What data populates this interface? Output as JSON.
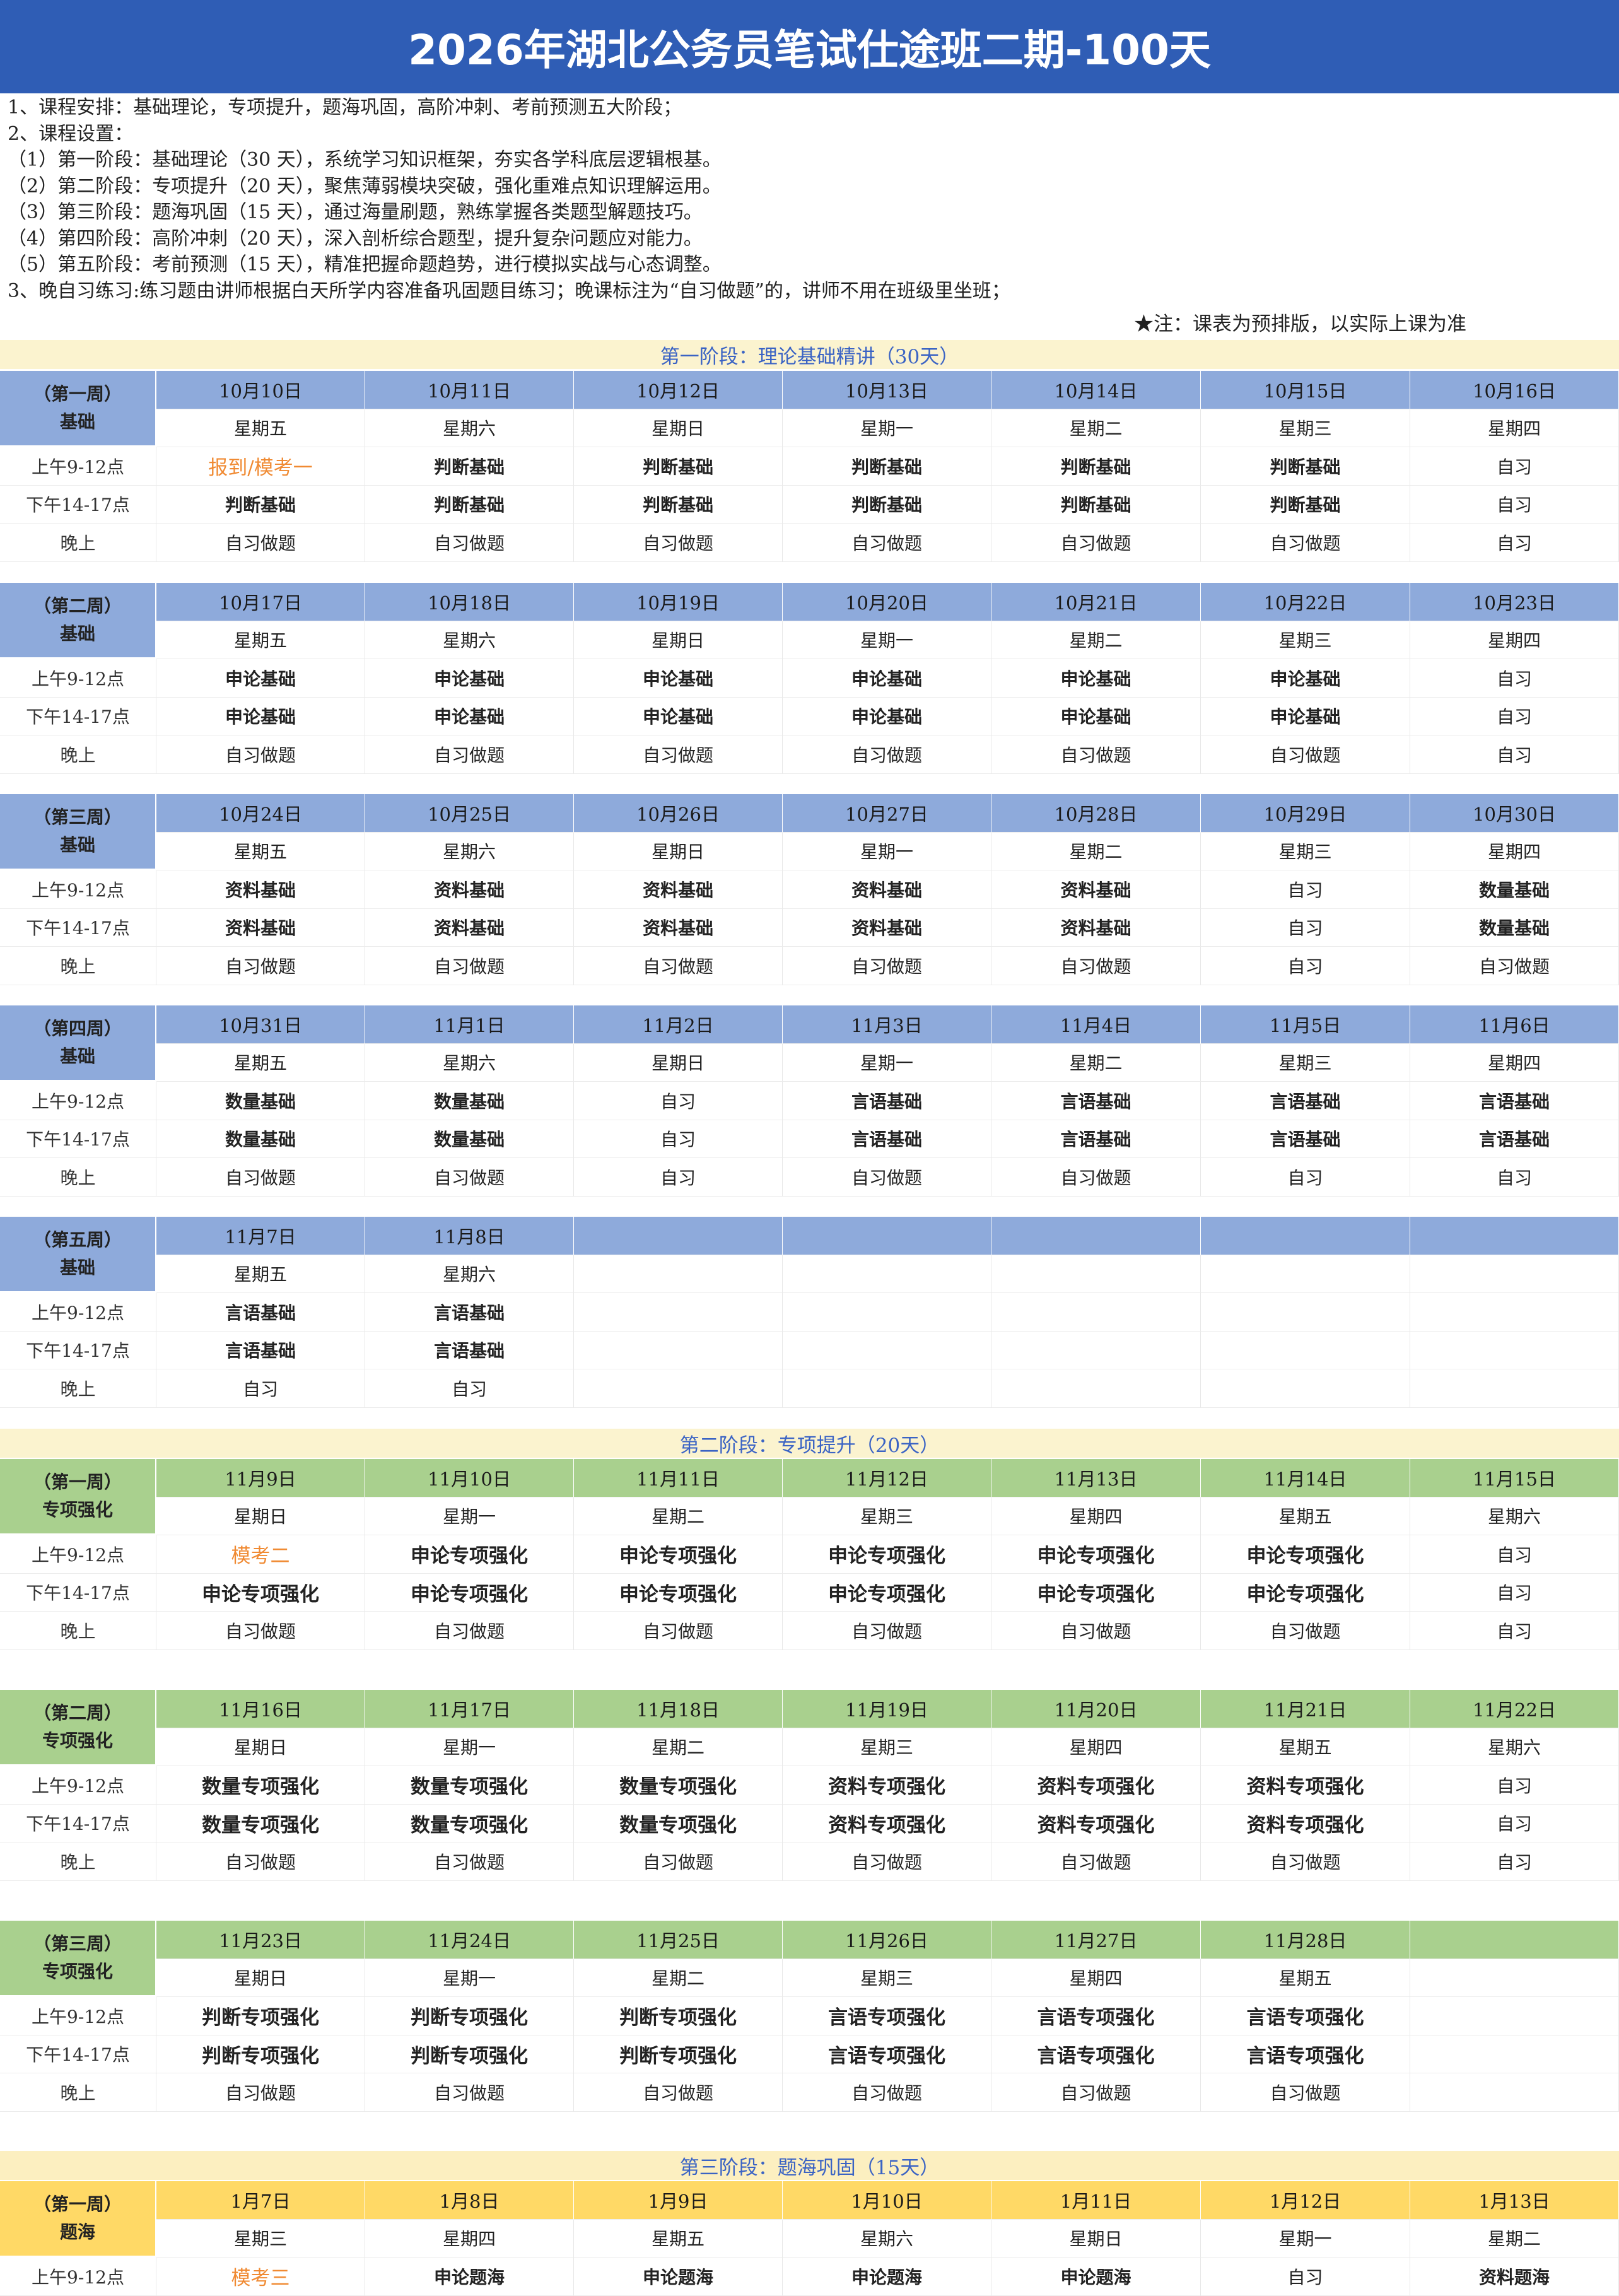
{
  "title": "2026年湖北公务员笔试仕途班二期-100天",
  "intro": [
    "1、课程安排：基础理论，专项提升，题海巩固，高阶冲刺、考前预测五大阶段；",
    "2、课程设置：",
    "（1）第一阶段：基础理论（30 天），系统学习知识框架，夯实各学科底层逻辑根基。",
    "（2）第二阶段：专项提升（20 天），聚焦薄弱模块突破，强化重难点知识理解运用。",
    "（3）第三阶段：题海巩固（15 天），通过海量刷题，熟练掌握各类题型解题技巧。",
    "（4）第四阶段：高阶冲刺（20 天），深入剖析综合题型，提升复杂问题应对能力。",
    "（5）第五阶段：考前预测（15 天），精准把握命题趋势，进行模拟实战与心态调整。",
    "3、晚自习练习:练习题由讲师根据白天所学内容准备巩固题目练习；晚课标注为“自习做题”的，讲师不用在班级里坐班；"
  ],
  "note": "★注：课表为预排版，以实际上课为准",
  "time_labels": [
    "上午9-12点",
    "下午14-17点",
    "晚上"
  ],
  "stages": [
    {
      "label": "第一阶段：理论基础精讲（30天）"
    },
    {
      "label": "第二阶段：专项提升（20天）"
    },
    {
      "label": "第三阶段：题海巩固（15天）"
    }
  ],
  "weeks": [
    {
      "label1": "（第一周）",
      "label2": "基础",
      "dates": [
        "10月10日",
        "10月11日",
        "10月12日",
        "10月13日",
        "10月14日",
        "10月15日",
        "10月16日"
      ],
      "days": [
        "星期五",
        "星期六",
        "星期日",
        "星期一",
        "星期二",
        "星期三",
        "星期四"
      ],
      "am": [
        "报到/模考一",
        "判断基础",
        "判断基础",
        "判断基础",
        "判断基础",
        "判断基础",
        "自习"
      ],
      "pm": [
        "判断基础",
        "判断基础",
        "判断基础",
        "判断基础",
        "判断基础",
        "判断基础",
        "自习"
      ],
      "eve": [
        "自习做题",
        "自习做题",
        "自习做题",
        "自习做题",
        "自习做题",
        "自习做题",
        "自习"
      ]
    },
    {
      "label1": "（第二周）",
      "label2": "基础",
      "dates": [
        "10月17日",
        "10月18日",
        "10月19日",
        "10月20日",
        "10月21日",
        "10月22日",
        "10月23日"
      ],
      "days": [
        "星期五",
        "星期六",
        "星期日",
        "星期一",
        "星期二",
        "星期三",
        "星期四"
      ],
      "am": [
        "申论基础",
        "申论基础",
        "申论基础",
        "申论基础",
        "申论基础",
        "申论基础",
        "自习"
      ],
      "pm": [
        "申论基础",
        "申论基础",
        "申论基础",
        "申论基础",
        "申论基础",
        "申论基础",
        "自习"
      ],
      "eve": [
        "自习做题",
        "自习做题",
        "自习做题",
        "自习做题",
        "自习做题",
        "自习做题",
        "自习"
      ]
    },
    {
      "label1": "（第三周）",
      "label2": "基础",
      "dates": [
        "10月24日",
        "10月25日",
        "10月26日",
        "10月27日",
        "10月28日",
        "10月29日",
        "10月30日"
      ],
      "days": [
        "星期五",
        "星期六",
        "星期日",
        "星期一",
        "星期二",
        "星期三",
        "星期四"
      ],
      "am": [
        "资料基础",
        "资料基础",
        "资料基础",
        "资料基础",
        "资料基础",
        "自习",
        "数量基础"
      ],
      "pm": [
        "资料基础",
        "资料基础",
        "资料基础",
        "资料基础",
        "资料基础",
        "自习",
        "数量基础"
      ],
      "eve": [
        "自习做题",
        "自习做题",
        "自习做题",
        "自习做题",
        "自习做题",
        "自习",
        "自习做题"
      ]
    },
    {
      "label1": "（第四周）",
      "label2": "基础",
      "dates": [
        "10月31日",
        "11月1日",
        "11月2日",
        "11月3日",
        "11月4日",
        "11月5日",
        "11月6日"
      ],
      "days": [
        "星期五",
        "星期六",
        "星期日",
        "星期一",
        "星期二",
        "星期三",
        "星期四"
      ],
      "am": [
        "数量基础",
        "数量基础",
        "自习",
        "言语基础",
        "言语基础",
        "言语基础",
        "言语基础"
      ],
      "pm": [
        "数量基础",
        "数量基础",
        "自习",
        "言语基础",
        "言语基础",
        "言语基础",
        "言语基础"
      ],
      "eve": [
        "自习做题",
        "自习做题",
        "自习",
        "自习做题",
        "自习做题",
        "自习",
        "自习"
      ]
    },
    {
      "label1": "（第五周）",
      "label2": "基础",
      "dates": [
        "11月7日",
        "11月8日",
        "",
        "",
        "",
        "",
        ""
      ],
      "days": [
        "星期五",
        "星期六",
        "",
        "",
        "",
        "",
        ""
      ],
      "am": [
        "言语基础",
        "言语基础",
        "",
        "",
        "",
        "",
        ""
      ],
      "pm": [
        "言语基础",
        "言语基础",
        "",
        "",
        "",
        "",
        ""
      ],
      "eve": [
        "自习",
        "自习",
        "",
        "",
        "",
        "",
        ""
      ]
    },
    {
      "label1": "（第一周）",
      "label2": "专项强化",
      "dates": [
        "11月9日",
        "11月10日",
        "11月11日",
        "11月12日",
        "11月13日",
        "11月14日",
        "11月15日"
      ],
      "days": [
        "星期日",
        "星期一",
        "星期二",
        "星期三",
        "星期四",
        "星期五",
        "星期六"
      ],
      "am": [
        "模考二",
        "申论专项强化",
        "申论专项强化",
        "申论专项强化",
        "申论专项强化",
        "申论专项强化",
        "自习"
      ],
      "pm": [
        "申论专项强化",
        "申论专项强化",
        "申论专项强化",
        "申论专项强化",
        "申论专项强化",
        "申论专项强化",
        "自习"
      ],
      "eve": [
        "自习做题",
        "自习做题",
        "自习做题",
        "自习做题",
        "自习做题",
        "自习做题",
        "自习"
      ]
    },
    {
      "label1": "（第二周）",
      "label2": "专项强化",
      "dates": [
        "11月16日",
        "11月17日",
        "11月18日",
        "11月19日",
        "11月20日",
        "11月21日",
        "11月22日"
      ],
      "days": [
        "星期日",
        "星期一",
        "星期二",
        "星期三",
        "星期四",
        "星期五",
        "星期六"
      ],
      "am": [
        "数量专项强化",
        "数量专项强化",
        "数量专项强化",
        "资料专项强化",
        "资料专项强化",
        "资料专项强化",
        "自习"
      ],
      "pm": [
        "数量专项强化",
        "数量专项强化",
        "数量专项强化",
        "资料专项强化",
        "资料专项强化",
        "资料专项强化",
        "自习"
      ],
      "eve": [
        "自习做题",
        "自习做题",
        "自习做题",
        "自习做题",
        "自习做题",
        "自习做题",
        "自习"
      ]
    },
    {
      "label1": "（第三周）",
      "label2": "专项强化",
      "dates": [
        "11月23日",
        "11月24日",
        "11月25日",
        "11月26日",
        "11月27日",
        "11月28日",
        ""
      ],
      "days": [
        "星期日",
        "星期一",
        "星期二",
        "星期三",
        "星期四",
        "星期五",
        ""
      ],
      "am": [
        "判断专项强化",
        "判断专项强化",
        "判断专项强化",
        "言语专项强化",
        "言语专项强化",
        "言语专项强化",
        ""
      ],
      "pm": [
        "判断专项强化",
        "判断专项强化",
        "判断专项强化",
        "言语专项强化",
        "言语专项强化",
        "言语专项强化",
        ""
      ],
      "eve": [
        "自习做题",
        "自习做题",
        "自习做题",
        "自习做题",
        "自习做题",
        "自习做题",
        ""
      ]
    },
    {
      "label1": "（第一周）",
      "label2": "题海",
      "dates": [
        "1月7日",
        "1月8日",
        "1月9日",
        "1月10日",
        "1月11日",
        "1月12日",
        "1月13日"
      ],
      "days": [
        "星期三",
        "星期四",
        "星期五",
        "星期六",
        "星期日",
        "星期一",
        "星期二"
      ],
      "am": [
        "模考三",
        "申论题海",
        "申论题海",
        "申论题海",
        "申论题海",
        "自习",
        "资料题海"
      ],
      "pm": [],
      "eve": []
    }
  ]
}
